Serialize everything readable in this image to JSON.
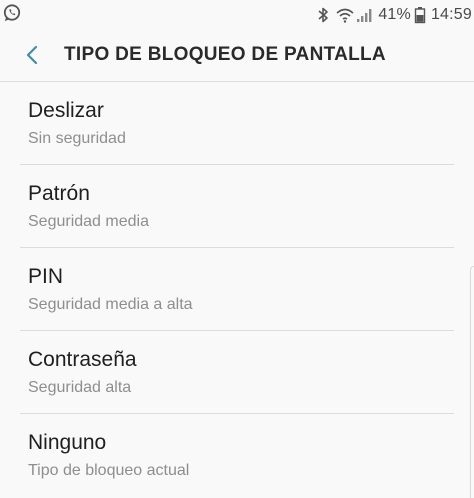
{
  "status_bar": {
    "left_icon": "whatsapp-icon",
    "icons": [
      "bluetooth-icon",
      "wifi-icon",
      "signal-icon",
      "battery-icon"
    ],
    "battery": "41%",
    "time": "14:59"
  },
  "header": {
    "back_icon": "chevron-left-icon",
    "title": "TIPO DE BLOQUEO DE PANTALLA",
    "accent_color": "#3d8fa8"
  },
  "options": [
    {
      "title": "Deslizar",
      "subtitle": "Sin seguridad"
    },
    {
      "title": "Patrón",
      "subtitle": "Seguridad media"
    },
    {
      "title": "PIN",
      "subtitle": "Seguridad media a alta"
    },
    {
      "title": "Contraseña",
      "subtitle": "Seguridad alta"
    },
    {
      "title": "Ninguno",
      "subtitle": "Tipo de bloqueo actual"
    }
  ]
}
